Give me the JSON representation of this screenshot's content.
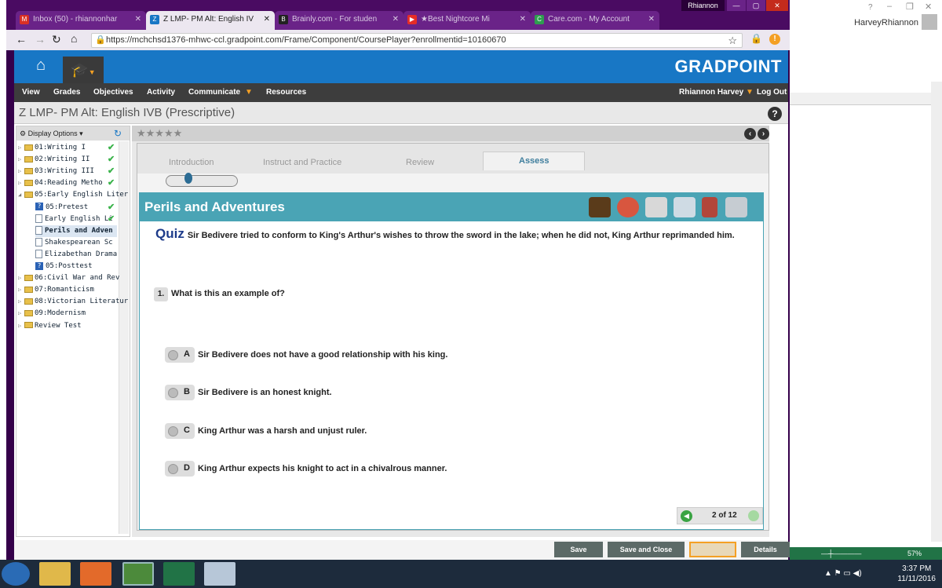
{
  "browser": {
    "tabs": [
      {
        "label": "Inbox (50) - rhiannonhar",
        "icon": "gmail-icon",
        "color": "#d93025"
      },
      {
        "label": "Z LMP- PM Alt: English IV",
        "icon": "gradpoint-icon",
        "color": "#1877c5"
      },
      {
        "label": "Brainly.com - For studen",
        "icon": "brainly-icon",
        "color": "#222"
      },
      {
        "label": "★Best Nightcore Mi",
        "icon": "youtube-icon",
        "color": "#e52d27"
      },
      {
        "label": "Care.com - My Account",
        "icon": "care-icon",
        "color": "#2e9e4f"
      }
    ],
    "profile": "Rhiannon",
    "url": "https://mchchsd1376-mhwc-ccl.gradpoint.com/Frame/Component/CoursePlayer?enrollmentid=10160670"
  },
  "app": {
    "logo": "GRADPOINT",
    "nav": [
      "View",
      "Grades",
      "Objectives",
      "Activity",
      "Communicate",
      "Resources"
    ],
    "user": "Rhiannon Harvey",
    "logout": "Log Out",
    "course_title": "Z LMP- PM Alt: English IVB (Prescriptive)"
  },
  "sidebar": {
    "display_options": "Display Options",
    "items": [
      {
        "label": "01:Writing I",
        "type": "folder",
        "done": true
      },
      {
        "label": "02:Writing II",
        "type": "folder",
        "done": true
      },
      {
        "label": "03:Writing III",
        "type": "folder",
        "done": true
      },
      {
        "label": "04:Reading Metho",
        "type": "folder",
        "done": true
      },
      {
        "label": "05:Early English Liter",
        "type": "folder-open",
        "done": false
      },
      {
        "label": "05:Pretest",
        "type": "quiz",
        "done": true
      },
      {
        "label": "Early English Li",
        "type": "doc",
        "done": true
      },
      {
        "label": "Perils and Adven",
        "type": "doc",
        "done": false
      },
      {
        "label": "Shakespearean Sc",
        "type": "doc",
        "done": false
      },
      {
        "label": "Elizabethan Drama",
        "type": "doc",
        "done": false
      },
      {
        "label": "05:Posttest",
        "type": "quiz",
        "done": false
      },
      {
        "label": "06:Civil War and Rev",
        "type": "folder",
        "done": false
      },
      {
        "label": "07:Romanticism",
        "type": "folder",
        "done": false
      },
      {
        "label": "08:Victorian Literatur",
        "type": "folder",
        "done": false
      },
      {
        "label": "09:Modernism",
        "type": "folder",
        "done": false
      },
      {
        "label": "Review Test",
        "type": "folder",
        "done": false
      }
    ]
  },
  "lesson": {
    "tabs": [
      "Introduction",
      "Instruct and Practice",
      "Review",
      "Assess"
    ],
    "active_tab": "Assess",
    "title": "Perils and Adventures",
    "quiz_word": "Quiz",
    "prompt": "Sir Bedivere tried to conform to King's Arthur's wishes to throw the sword in the lake; when he did not, King Arthur reprimanded him.",
    "question_number": "1.",
    "question": "What is this an example of?",
    "options": [
      {
        "letter": "A",
        "text": "Sir Bedivere does not have a good relationship with his king."
      },
      {
        "letter": "B",
        "text": "Sir Bedivere is an honest knight."
      },
      {
        "letter": "C",
        "text": "King Arthur was a harsh and unjust ruler."
      },
      {
        "letter": "D",
        "text": "King Arthur expects his knight to act in a chivalrous manner."
      }
    ],
    "pager": "2 of 12"
  },
  "buttons": {
    "save": "Save",
    "save_close": "Save and Close",
    "details": "Details"
  },
  "word": {
    "user": "HarveyRhiannon",
    "zoom": "57%"
  },
  "taskbar": {
    "time": "3:37 PM",
    "date": "11/11/2016"
  }
}
